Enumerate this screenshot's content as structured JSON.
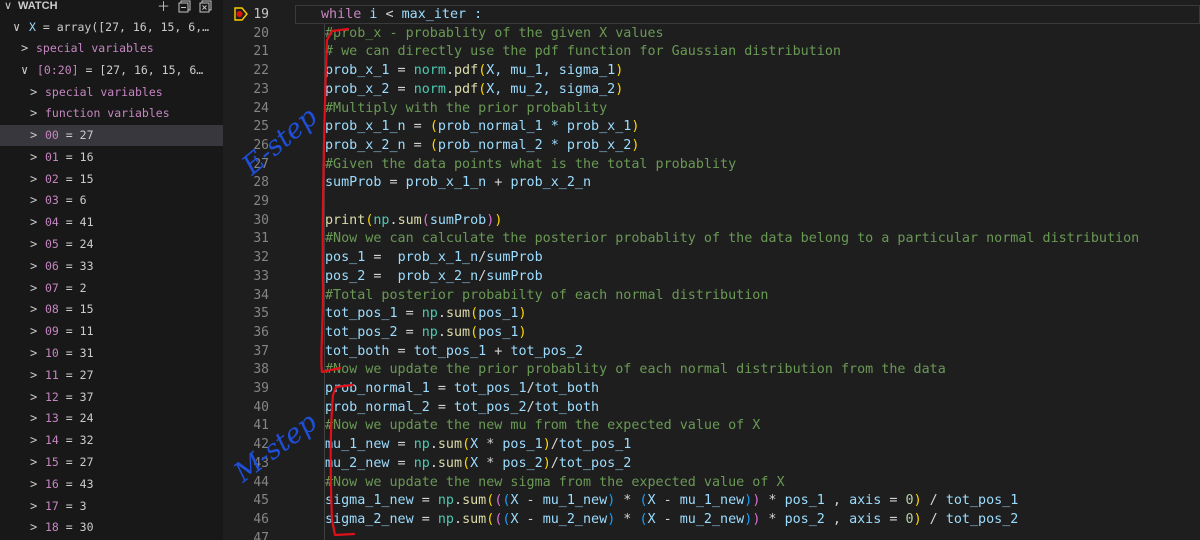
{
  "watch": {
    "title": "WATCH",
    "add_icon": "plus-icon",
    "collapse_icon": "collapse-all-icon",
    "remove_icon": "remove-all-icon",
    "root": {
      "name": "X",
      "sep": " = ",
      "value": "array([27, 16, 15,  6,…"
    },
    "special_variables": "special variables",
    "slice": {
      "name": "[0:20]",
      "sep": " = ",
      "value": "[27, 16, 15, 6…"
    },
    "slice_special": "special variables",
    "slice_function": "function variables",
    "items": [
      {
        "index": "00",
        "value": "27"
      },
      {
        "index": "01",
        "value": "16"
      },
      {
        "index": "02",
        "value": "15"
      },
      {
        "index": "03",
        "value": "6"
      },
      {
        "index": "04",
        "value": "41"
      },
      {
        "index": "05",
        "value": "24"
      },
      {
        "index": "06",
        "value": "33"
      },
      {
        "index": "07",
        "value": "2"
      },
      {
        "index": "08",
        "value": "15"
      },
      {
        "index": "09",
        "value": "11"
      },
      {
        "index": "10",
        "value": "31"
      },
      {
        "index": "11",
        "value": "27"
      },
      {
        "index": "12",
        "value": "37"
      },
      {
        "index": "13",
        "value": "24"
      },
      {
        "index": "14",
        "value": "32"
      },
      {
        "index": "15",
        "value": "27"
      },
      {
        "index": "16",
        "value": "43"
      },
      {
        "index": "17",
        "value": "3"
      },
      {
        "index": "18",
        "value": "30"
      }
    ]
  },
  "editor": {
    "current_line": "19",
    "line_numbers": [
      "19",
      "20",
      "21",
      "22",
      "23",
      "24",
      "25",
      "26",
      "27",
      "28",
      "29",
      "30",
      "31",
      "32",
      "33",
      "34",
      "35",
      "36",
      "37",
      "38",
      "39",
      "40",
      "41",
      "42",
      "43",
      "44",
      "45",
      "46",
      "47"
    ],
    "code": {
      "l19": {
        "kw": "while",
        "t1": " i ",
        "op": "<",
        "t2": " max_iter :"
      },
      "l20": "#prob_x - probablity of the given X values",
      "l21": "# we can directly use the pdf function for Gaussian distribution",
      "l22": {
        "var": "prob_x_1",
        "eq": " = ",
        "obj": "norm",
        "dot": ".",
        "fn": "pdf",
        "args": "X, mu_1, sigma_1"
      },
      "l23": {
        "var": "prob_x_2",
        "eq": " = ",
        "obj": "norm",
        "dot": ".",
        "fn": "pdf",
        "args": "X, mu_2, sigma_2"
      },
      "l24": "#Multiply with the prior probablity",
      "l25": {
        "var": "prob_x_1_n",
        "eq": " = ",
        "expr": "prob_normal_1 * prob_x_1"
      },
      "l26": {
        "var": "prob_x_2_n",
        "eq": " = ",
        "expr": "prob_normal_2 * prob_x_2"
      },
      "l27": "#Given the data points what is the total probablity",
      "l28": {
        "var": "sumProb",
        "eq": " = ",
        "a": "prob_x_1_n",
        "op": " + ",
        "b": "prob_x_2_n"
      },
      "l30": {
        "fn": "print",
        "mod": "np",
        "dot": ".",
        "fn2": "sum",
        "arg": "sumProb"
      },
      "l31": "#Now we can calculate the posterior probablity of the data belong to a particular normal distribution",
      "l32": {
        "var": "pos_1",
        "eq": " =  ",
        "a": "prob_x_1_n",
        "op": "/",
        "b": "sumProb"
      },
      "l33": {
        "var": "pos_2",
        "eq": " =  ",
        "a": "prob_x_2_n",
        "op": "/",
        "b": "sumProb"
      },
      "l34": "#Total posterior probabilty of each normal distribution",
      "l35": {
        "var": "tot_pos_1",
        "eq": " = ",
        "mod": "np",
        "dot": ".",
        "fn": "sum",
        "arg": "pos_1"
      },
      "l36": {
        "var": "tot_pos_2",
        "eq": " = ",
        "mod": "np",
        "dot": ".",
        "fn": "sum",
        "arg": "pos_1"
      },
      "l37": {
        "var": "tot_both",
        "eq": " = ",
        "a": "tot_pos_1",
        "op": " + ",
        "b": "tot_pos_2"
      },
      "l38": "#Now we update the prior probablity of each normal distribution from the data",
      "l39": {
        "var": "prob_normal_1",
        "eq": " = ",
        "a": "tot_pos_1",
        "op": "/",
        "b": "tot_both"
      },
      "l40": {
        "var": "prob_normal_2",
        "eq": " = ",
        "a": "tot_pos_2",
        "op": "/",
        "b": "tot_both"
      },
      "l41": "#Now we update the new mu from the expected value of X",
      "l42": {
        "var": "mu_1_new",
        "eq": " = ",
        "mod": "np",
        "dot": ".",
        "fn": "sum",
        "x": "X",
        "mul": " * ",
        "w": "pos_1",
        "op": "/",
        "d": "tot_pos_1"
      },
      "l43": {
        "var": "mu_2_new",
        "eq": " = ",
        "mod": "np",
        "dot": ".",
        "fn": "sum",
        "x": "X",
        "mul": " * ",
        "w": "pos_2",
        "op": "/",
        "d": "tot_pos_2"
      },
      "l44": "#Now we update the new sigma from the expected value of X",
      "l45": {
        "var": "sigma_1_new",
        "eq": " = ",
        "mod": "np",
        "dot": ".",
        "fn": "sum",
        "x1": "X",
        "m1": " - ",
        "mu1": "mu_1_new",
        "mul": " * ",
        "x2": "X",
        "m2": " - ",
        "mu2": "mu_1_new",
        "mul2": " * ",
        "w": "pos_1",
        "comma": " , ",
        "kw": "axis",
        "keq": " = ",
        "num": "0",
        "div": " / ",
        "d": "tot_pos_1"
      },
      "l46": {
        "var": "sigma_2_new",
        "eq": " = ",
        "mod": "np",
        "dot": ".",
        "fn": "sum",
        "x1": "X",
        "m1": " - ",
        "mu1": "mu_2_new",
        "mul": " * ",
        "x2": "X",
        "m2": " - ",
        "mu2": "mu_2_new",
        "mul2": " * ",
        "w": "pos_2",
        "comma": " , ",
        "kw": "axis",
        "keq": " = ",
        "num": "0",
        "div": " / ",
        "d": "tot_pos_2"
      }
    }
  },
  "annotations": {
    "e_step": "E-step",
    "m_step": "M-step",
    "color": "#e0101a",
    "text_color": "#1f4fd8"
  }
}
